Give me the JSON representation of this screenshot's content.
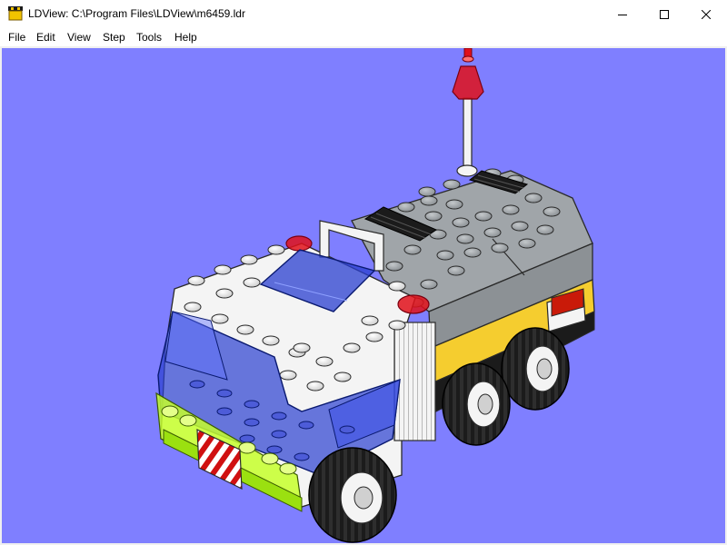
{
  "window": {
    "title": "LDView: C:\\Program Files\\LDView\\m6459.ldr",
    "app_icon": "ldview-app-icon",
    "controls": {
      "minimize_icon": "minimize-icon",
      "maximize_icon": "maximize-icon",
      "close_icon": "close-icon"
    }
  },
  "menu": {
    "items": [
      {
        "label": "File"
      },
      {
        "label": "Edit"
      },
      {
        "label": "View"
      },
      {
        "label": "Step"
      },
      {
        "label": "Tools"
      },
      {
        "label": "Help"
      }
    ]
  },
  "viewport": {
    "background_color": "#7f7fff",
    "model": "lego-truck-model",
    "colors": {
      "white": "#f4f4f4",
      "gray": "#a0a5a9",
      "yellow": "#f5cd2f",
      "black": "#1b1b1b",
      "trans_blue": "#2a3fd0",
      "trans_red": "#e0101a",
      "trans_neon_green": "#c6ff2a",
      "red": "#c91a09"
    }
  }
}
